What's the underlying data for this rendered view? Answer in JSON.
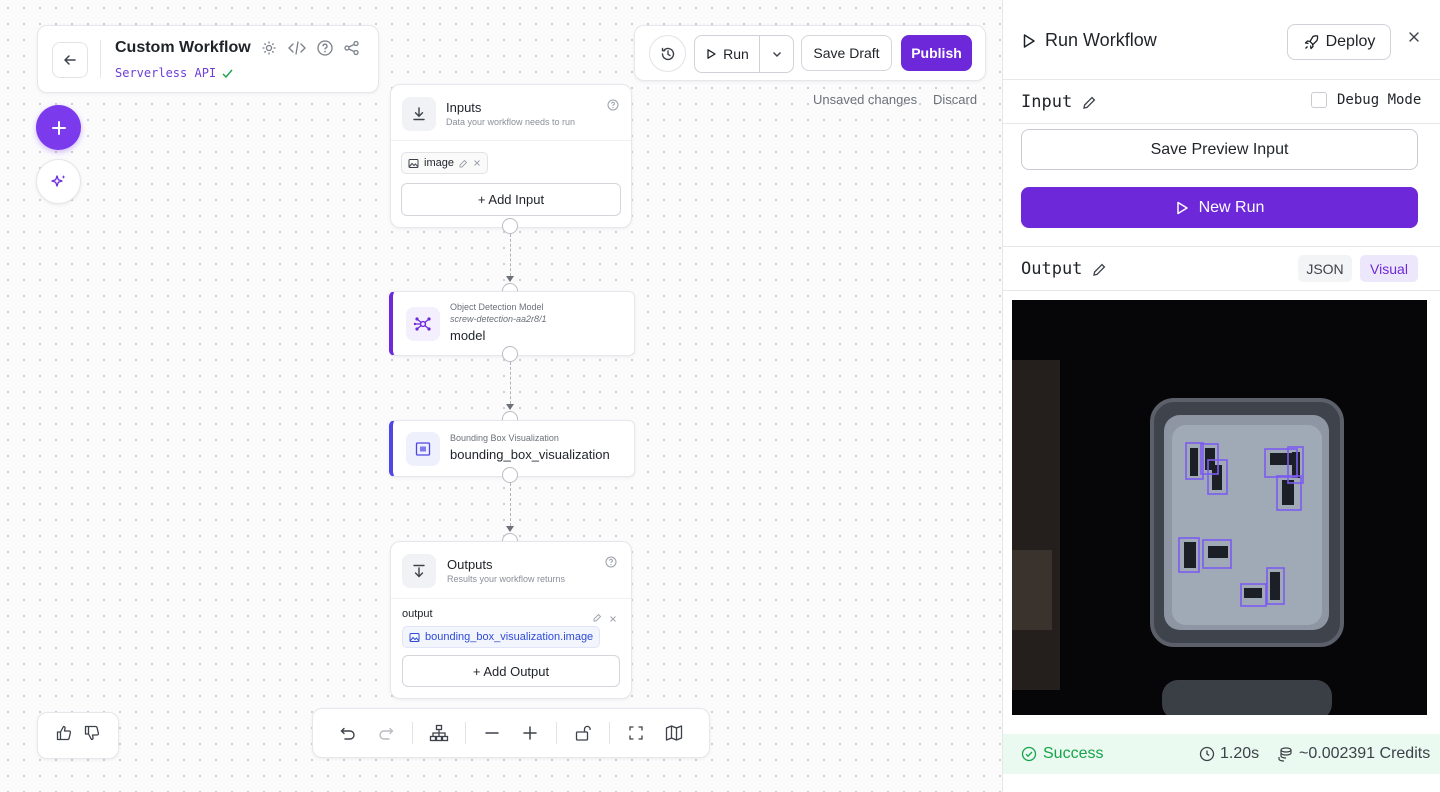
{
  "header": {
    "title": "Custom Workflow",
    "subtitle": "Serverless API",
    "icons": [
      "settings-icon",
      "code-icon",
      "help-icon",
      "share-icon"
    ]
  },
  "toolbar": {
    "run_label": "Run",
    "save_draft_label": "Save Draft",
    "publish_label": "Publish",
    "unsaved_text": "Unsaved changes",
    "discard_label": "Discard"
  },
  "nodes": {
    "inputs": {
      "title": "Inputs",
      "subtitle": "Data your workflow needs to run",
      "chip": "image",
      "add_label": "+ Add Input"
    },
    "model": {
      "type_label": "Object Detection Model",
      "model_id": "screw-detection-aa2r8/1",
      "name": "model"
    },
    "bbox": {
      "type_label": "Bounding Box Visualization",
      "name": "bounding_box_visualization"
    },
    "outputs": {
      "title": "Outputs",
      "subtitle": "Results your workflow returns",
      "output_name": "output",
      "chip": "bounding_box_visualization.image",
      "add_label": "+ Add Output"
    }
  },
  "panel": {
    "title": "Run Workflow",
    "deploy_label": "Deploy",
    "input_label": "Input",
    "debug_label": "Debug Mode",
    "save_preview_label": "Save Preview Input",
    "new_run_label": "New Run",
    "output_label": "Output",
    "view_json": "JSON",
    "view_visual": "Visual",
    "status": "Success",
    "duration": "1.20s",
    "credits": "~0.002391 Credits"
  },
  "colors": {
    "accent": "#6d28d9",
    "success": "#16a34a",
    "success_bg": "#eafaf1"
  }
}
